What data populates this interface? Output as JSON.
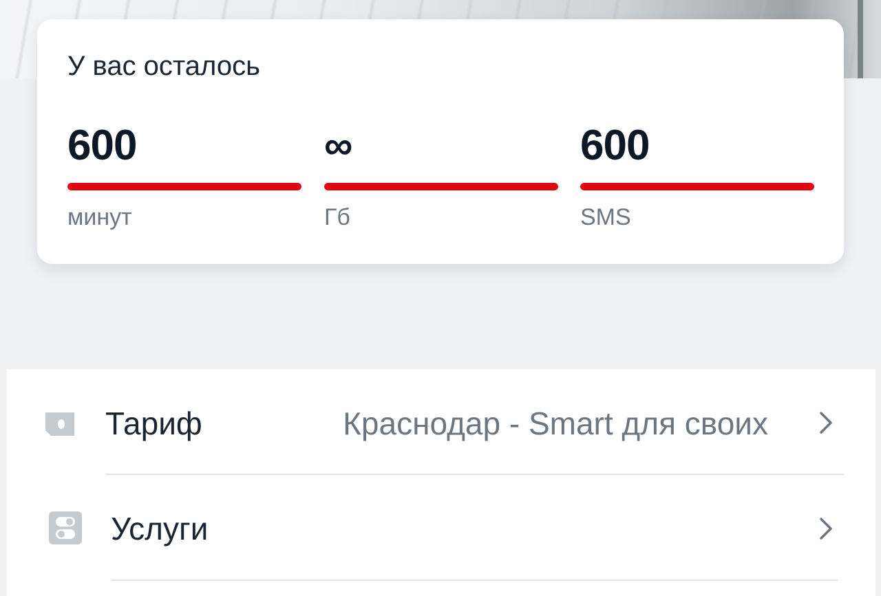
{
  "balance": {
    "title": "У вас осталось",
    "metrics": [
      {
        "value": "600",
        "unit": "минут",
        "level": 1.0
      },
      {
        "value": "∞",
        "unit": "Гб",
        "level": 1.0
      },
      {
        "value": "600",
        "unit": "SMS",
        "level": 1.0
      }
    ]
  },
  "menu": {
    "items": [
      {
        "label": "Тариф",
        "value": "Краснодар - Smart для своих",
        "icon": "sim-card-icon"
      },
      {
        "label": "Услуги",
        "value": "",
        "icon": "toggle-switches-icon"
      }
    ]
  },
  "colors": {
    "accent": "#e30611",
    "background": "#eff1f3",
    "text_primary": "#1b2431",
    "text_secondary": "#6d7680",
    "icon_gray": "#c5cacf"
  }
}
